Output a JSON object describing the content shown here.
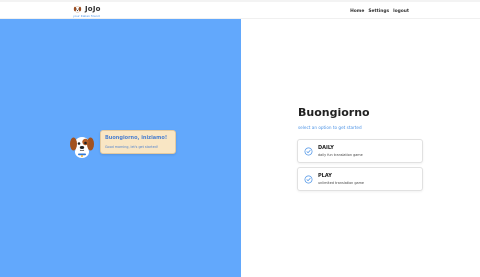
{
  "brand": {
    "name": "JoJo",
    "tagline": "your italian friend"
  },
  "nav": {
    "items": [
      "Home",
      "Settings",
      "logout"
    ]
  },
  "bubble": {
    "title": "Buongiorno, iniziamo!",
    "subtitle": "Good morning, let's get started!"
  },
  "main": {
    "greeting": "Buongiorno",
    "subtitle": "select an option to get started",
    "options": [
      {
        "title": "DAILY",
        "description": "daily fun translation game",
        "icon": "check-circle-icon"
      },
      {
        "title": "PLAY",
        "description": "unlimited translation game",
        "icon": "check-circle-icon"
      }
    ]
  },
  "colors": {
    "accent": "#4c93e6",
    "left_panel": "#62a8fc",
    "bubble": "#f9e6c4"
  }
}
